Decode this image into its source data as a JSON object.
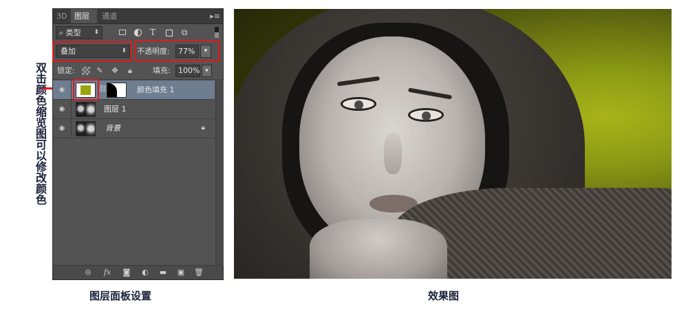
{
  "side_note": "双击颜色缩览图可以修改颜色",
  "panel": {
    "tabs": [
      "3D",
      "图层",
      "通道"
    ],
    "menu_glyph": "▸≡",
    "filter": {
      "label": "类型",
      "search_glyph": "⌕"
    },
    "blend_mode": "叠加",
    "opacity_label": "不透明度:",
    "opacity_value": "77%",
    "lock_label": "锁定:",
    "fill_label": "填充:",
    "fill_value": "100%",
    "layers": [
      {
        "name": "颜色填充 1",
        "type": "color-fill",
        "fill_color": "#9aa40c",
        "selected": true
      },
      {
        "name": "图层 1",
        "type": "image",
        "selected": false
      },
      {
        "name": "背景",
        "type": "background",
        "locked": true,
        "selected": false
      }
    ]
  },
  "captions": {
    "left": "图层面板设置",
    "right": "效果图"
  },
  "colors": {
    "highlight": "#e0191b",
    "panel_bg": "#535353",
    "selected_row": "#6f7d91"
  }
}
